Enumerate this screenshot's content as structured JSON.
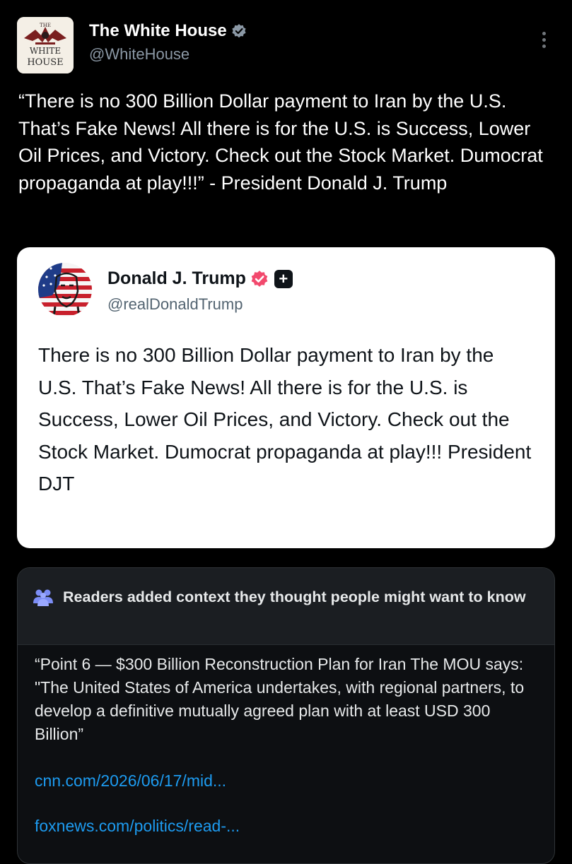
{
  "post": {
    "display_name": "The White House",
    "handle": "@WhiteHouse",
    "avatar_text": [
      "THE",
      "WHITE",
      "HOUSE"
    ],
    "text": "“There is no 300 Billion Dollar payment to Iran by the U.S. That’s Fake News! All there is for the U.S. is Success, Lower Oil Prices, and Victory. Check out the Stock Market. Dumocrat propaganda at play!!!” - President Donald J. Trump",
    "more_icon": "more-vertical-icon",
    "verified_icon": "verified-gray-badge-icon"
  },
  "quote": {
    "display_name": "Donald J. Trump",
    "handle": "@realDonaldTrump",
    "badge_icons": [
      "verified-red-badge-icon",
      "plus-badge-icon"
    ],
    "plus_glyph": "+",
    "text": "There is no 300 Billion Dollar payment to Iran by the U.S. That’s Fake News! All there is for the U.S. is Success, Lower Oil Prices, and Victory. Check out the Stock Market. Dumocrat propaganda at play!!! President DJT"
  },
  "community_note": {
    "icon": "people-icon",
    "title": "Readers added context they thought people might want to know",
    "body": "“Point 6 — $300 Billion Reconstruction Plan for Iran The MOU says:  \"The United States of America undertakes, with regional partners, to develop a definitive mutually agreed plan with at least USD 300 Billion”",
    "links": [
      "cnn.com/2026/06/17/mid...",
      "foxnews.com/politics/read-..."
    ]
  },
  "colors": {
    "background": "#000000",
    "text_primary": "#e7e9ea",
    "text_secondary": "#8b98a5",
    "link": "#1d9bf0",
    "trump_badge": "#f2496d",
    "quote_card_bg": "#ffffff"
  }
}
